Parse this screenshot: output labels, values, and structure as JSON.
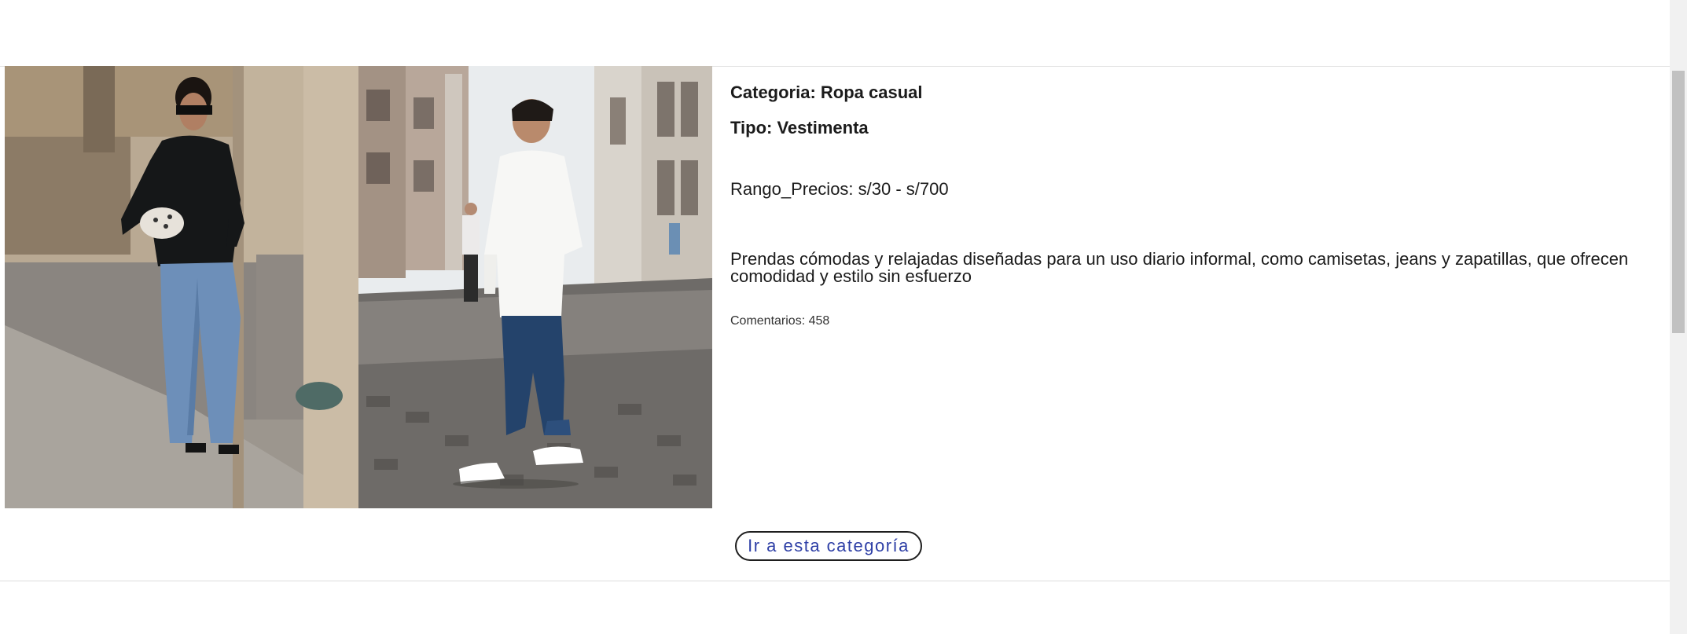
{
  "category": {
    "heading": "Categoria: Ropa casual",
    "type": "Tipo: Vestimenta",
    "price_range": "Rango_Precios: s/30 - s/700",
    "description": "Prendas cómodas y relajadas diseñadas para un uso diario informal, como camisetas, jeans y zapatillas, que ofrecen comodidad y estilo sin esfuerzo",
    "comments": "Comentarios: 458",
    "cta_label": "Ir a esta categoría"
  },
  "images": [
    {
      "semantic": "woman-casual-outfit-photo"
    },
    {
      "semantic": "man-casual-outfit-photo"
    }
  ],
  "colors": {
    "cta_text": "#2e3fa6",
    "cta_border": "#1e1e1e",
    "divider": "#e3e3e3"
  }
}
